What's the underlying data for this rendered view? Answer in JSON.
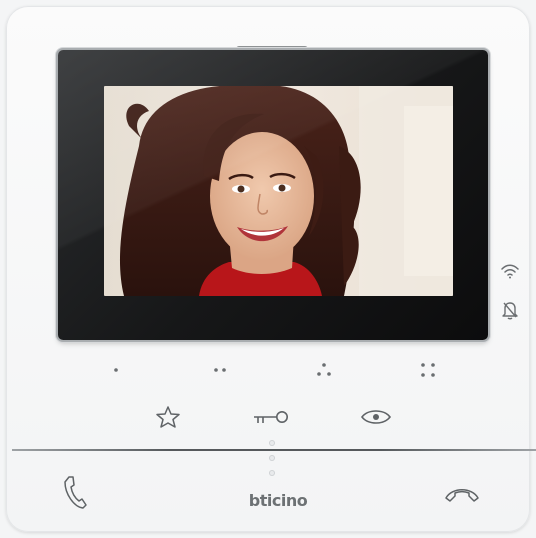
{
  "device": {
    "brand": "bticino"
  },
  "screen": {
    "content": "video-feed-visitor"
  },
  "side_indicators": [
    {
      "name": "wifi-icon"
    },
    {
      "name": "bell-off-icon"
    }
  ],
  "touch_keys": [
    {
      "name": "touch-key-1",
      "dots": 1
    },
    {
      "name": "touch-key-2",
      "dots": 2
    },
    {
      "name": "touch-key-3",
      "dots": 3
    },
    {
      "name": "touch-key-4",
      "dots": 4
    }
  ],
  "function_keys": [
    {
      "name": "favorite-star-icon"
    },
    {
      "name": "door-key-icon"
    },
    {
      "name": "eye-icon"
    }
  ],
  "call_keys": [
    {
      "name": "answer-call-icon"
    },
    {
      "name": "end-call-icon"
    }
  ],
  "colors": {
    "body": "#f3f4f5",
    "bezel": "#161718",
    "icon": "#5f6366",
    "brand": "#6d7174"
  }
}
